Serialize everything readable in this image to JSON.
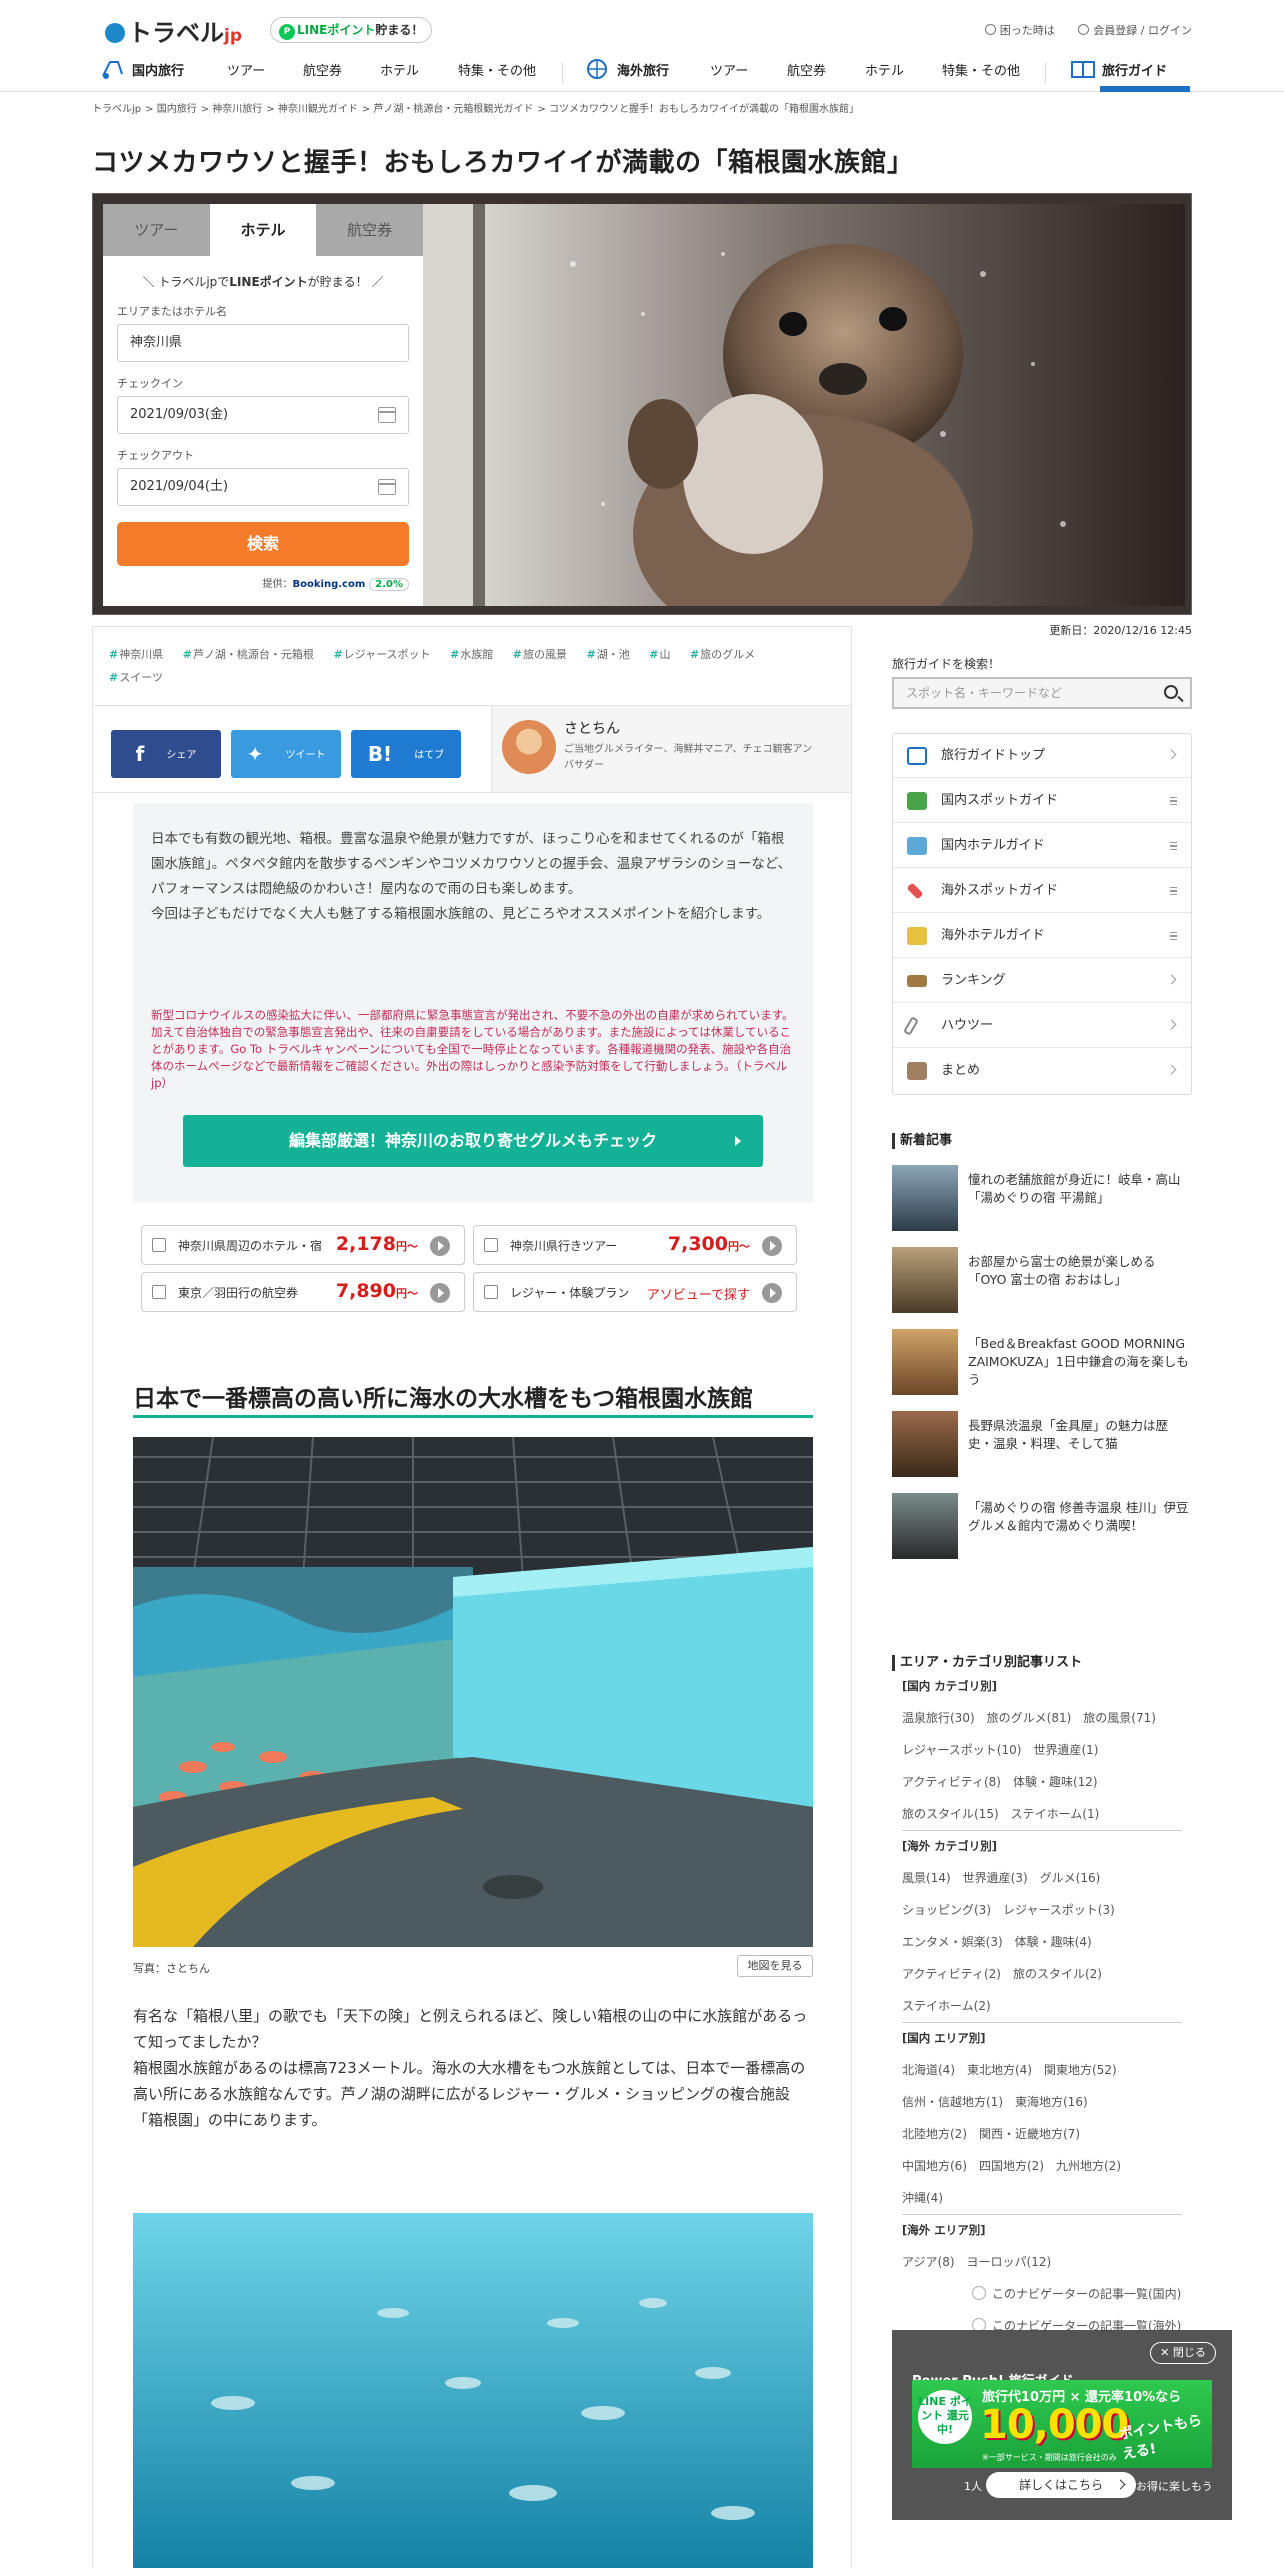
{
  "header": {
    "logo_text": "トラベル",
    "logo_suffix": "jp",
    "line_prefix": "LINE",
    "line_mid": "ポイント",
    "line_suffix": "貯まる！",
    "help": "困った時は",
    "login": "会員登録 / ログイン"
  },
  "nav": {
    "domestic": "国内旅行",
    "items_dom": [
      "ツアー",
      "航空券",
      "ホテル",
      "特集・その他"
    ],
    "overseas": "海外旅行",
    "items_int": [
      "ツアー",
      "航空券",
      "ホテル",
      "特集・その他"
    ],
    "guide": "旅行ガイド"
  },
  "breadcrumb": [
    "トラベルjp",
    "国内旅行",
    "神奈川旅行",
    "神奈川観光ガイド",
    "芦ノ湖・桃源台・元箱根観光ガイド",
    "コツメカワウソと握手！おもしろカワイイが満載の「箱根園水族館」"
  ],
  "title": "コツメカワウソと握手！おもしろカワイイが満載の「箱根園水族館」",
  "search": {
    "tabs": [
      "ツアー",
      "ホテル",
      "航空券"
    ],
    "active_tab": "ホテル",
    "head_pre": "＼ トラベルjpで",
    "head_bold": "LINEポイント",
    "head_post": "が貯まる！ ／",
    "area_label": "エリアまたはホテル名",
    "area_value": "神奈川県",
    "checkin_label": "チェックイン",
    "checkin_value": "2021/09/03(金)",
    "checkout_label": "チェックアウト",
    "checkout_value": "2021/09/04(土)",
    "button": "検索",
    "provided_by": "提供：",
    "provider": "Booking.com",
    "point_rate": "2.0%"
  },
  "updated": "更新日：2020/12/16 12:45",
  "tags": [
    "神奈川県",
    "芦ノ湖・桃源台・元箱根",
    "レジャースポット",
    "水族館",
    "旅の風景",
    "湖・池",
    "山",
    "旅のグルメ",
    "スイーツ"
  ],
  "share": {
    "facebook": "シェア",
    "twitter": "ツイート",
    "hatena": "はてブ"
  },
  "author": {
    "name": "さとちん",
    "desc": "ご当地グルメライター、海鮮丼マニア、チェコ観客アンバサダー"
  },
  "intro": {
    "text": "日本でも有数の観光地、箱根。豊富な温泉や絶景が魅力ですが、ほっこり心を和ませてくれるのが「箱根園水族館」。ペタペタ館内を散歩するペンギンやコツメカワウソとの握手会、温泉アザラシのショーなど、パフォーマンスは悶絶級のかわいさ！屋内なので雨の日も楽しめます。",
    "text2": "今回は子どもだけでなく大人も魅了する箱根園水族館の、見どころやオススメポイントを紹介します。",
    "covid": "新型コロナウイルスの感染拡大に伴い、一部都府県に緊急事態宣言が発出され、不要不急の外出の自粛が求められています。加えて自治体独自での緊急事態宣言発出や、往来の自粛要請をしている場合があります。また施設によっては休業していることがあります。Go To トラベルキャンペーンについても全国で一時停止となっています。各種報道機関の発表、施設や各自治体のホームページなどで最新情報をご確認ください。外出の際はしっかりと感染予防対策をして行動しましょう。（トラベルjp）",
    "button": "編集部厳選！神奈川のお取り寄せグルメもチェック"
  },
  "quick": [
    {
      "label": "神奈川県周辺のホテル・宿",
      "value": "2,178",
      "unit": "円～"
    },
    {
      "label": "神奈川県行きツアー",
      "value": "7,300",
      "unit": "円～"
    },
    {
      "label": "東京／羽田行の航空券",
      "value": "7,890",
      "unit": "円～"
    },
    {
      "label": "レジャー・体験プラン",
      "text": "アソビューで探す"
    }
  ],
  "section": {
    "heading": "日本で一番標高の高い所に海水の大水槽をもつ箱根園水族館",
    "credit": "写真：さとちん",
    "map": "地図を見る",
    "body": "有名な「箱根八里」の歌でも「天下の険」と例えられるほど、険しい箱根の山の中に水族館があるって知ってましたか？",
    "body2": "箱根園水族館があるのは標高723メートル。海水の大水槽をもつ水族館としては、日本で一番標高の高い所にある水族館なんです。芦ノ湖の湖畔に広がるレジャー・グルメ・ショッピングの複合施設「箱根園」の中にあります。"
  },
  "sidebar": {
    "search_label": "旅行ガイドを検索！",
    "search_placeholder": "スポット名・キーワードなど",
    "menu": [
      "旅行ガイドトップ",
      "国内スポットガイド",
      "国内ホテルガイド",
      "海外スポットガイド",
      "海外ホテルガイド",
      "ランキング",
      "ハウツー",
      "まとめ"
    ],
    "new_title": "新着記事",
    "news": [
      "憧れの老舗旅館が身近に！岐阜・高山「湯めぐりの宿 平湯館」",
      "お部屋から富士の絶景が楽しめる「OYO 富士の宿 おおはし」",
      "「Bed＆Breakfast GOOD MORNING ZAIMOKUZA」1日中鎌倉の海を楽しもう",
      "長野県渋温泉「金具屋」の魅力は歴史・温泉・料理、そして猫",
      "「湯めぐりの宿 修善寺温泉 桂川」伊豆グルメ＆館内で湯めぐり満喫！"
    ],
    "cat_title": "エリア・カテゴリ別記事リスト",
    "dom_cat_h": "[国内 カテゴリ別]",
    "dom_cat": [
      "温泉旅行(30)",
      "旅のグルメ(81)",
      "旅の風景(71)",
      "レジャースポット(10)",
      "世界遺産(1)",
      "アクティビティ(8)",
      "体験・趣味(12)",
      "旅のスタイル(15)",
      "ステイホーム(1)"
    ],
    "int_cat_h": "[海外 カテゴリ別]",
    "int_cat": [
      "風景(14)",
      "世界遺産(3)",
      "グルメ(16)",
      "ショッピング(3)",
      "レジャースポット(3)",
      "エンタメ・娯楽(3)",
      "体験・趣味(4)",
      "アクティビティ(2)",
      "旅のスタイル(2)",
      "ステイホーム(2)"
    ],
    "dom_area_h": "[国内 エリア別]",
    "dom_area": [
      "北海道(4)",
      "東北地方(4)",
      "関東地方(52)",
      "信州・信越地方(1)",
      "東海地方(16)",
      "北陸地方(2)",
      "関西・近畿地方(7)",
      "中国地方(6)",
      "四国地方(2)",
      "九州地方(2)",
      "沖縄(4)"
    ],
    "int_area_h": "[海外 エリア別]",
    "int_area": [
      "アジア(8)",
      "ヨーロッパ(12)"
    ],
    "link_dom": "このナビゲーターの記事一覧(国内)",
    "link_int": "このナビゲーターの記事一覧(海外)"
  },
  "popup": {
    "close": "閉じる",
    "title": "Power Push! 旅行ガイド",
    "banner_line": "LINE ポイント 還元中!",
    "banner_top": "旅行代10万円 × 還元率10%なら",
    "banner_big": "10,000",
    "banner_unit": "ポイントもらえる!",
    "banner_note": "※一部サービス・期間は旅行会社のみ",
    "button": "詳しくはこちら",
    "behind": "1人　　　　　　　　　県内旅行をお得に楽しもう"
  },
  "colors": {
    "accent_green": "#13b195",
    "orange": "#f47b2a",
    "price_red": "#d41d1d",
    "nav_active": "#1d6fc4"
  }
}
